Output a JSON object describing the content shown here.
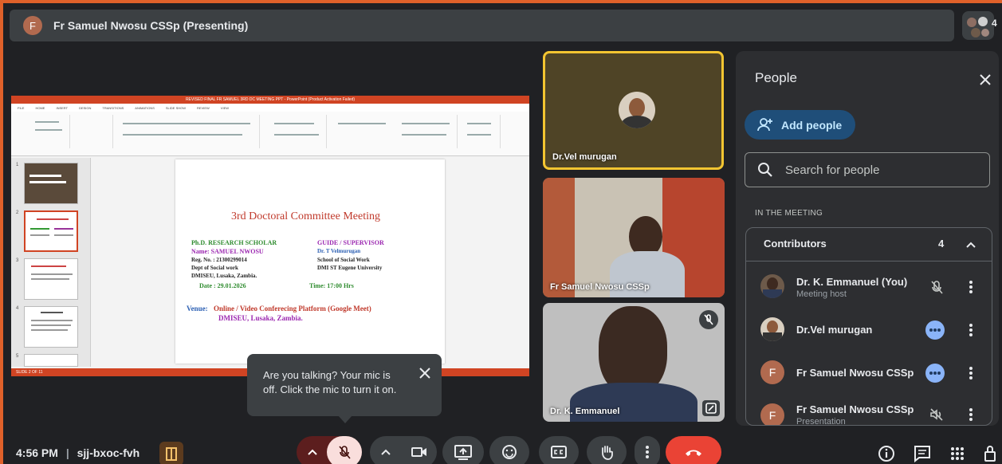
{
  "header": {
    "avatar_letter": "F",
    "title": "Fr Samuel Nwosu CSSp (Presenting)",
    "participant_count": "4"
  },
  "presentation": {
    "window_title": "REVISED FINAL FR SAMUEL 3RD DC MEETING PPT - PowerPoint (Product Activation Failed)",
    "tabs": [
      "FILE",
      "HOME",
      "INSERT",
      "DESIGN",
      "TRANSITIONS",
      "ANIMATIONS",
      "SLIDE SHOW",
      "REVIEW",
      "VIEW"
    ],
    "thumb_numbers": [
      "1",
      "2",
      "3",
      "4",
      "5"
    ],
    "slide": {
      "title": "3rd   Doctoral Committee Meeting",
      "scholar_heading": "Ph.D. RESEARCH SCHOLAR",
      "scholar_name": "Name: SAMUEL NWOSU",
      "reg_no": "Reg. No. : 21300299014",
      "dept": "Dept of Social work",
      "institution": "DMISEU, Lusaka, Zambia.",
      "date": "Date : 29.01.2026",
      "guide_heading": "GUIDE / SUPERVISOR",
      "guide_name": "Dr. T Velmurugan",
      "guide_school": "School of Social Work",
      "guide_univ": "DMI ST Eugene University",
      "time": "Time: 17:00 Hrs",
      "venue_label": "Venue:",
      "venue_value": "Online / Video Conferecing Platform (Google Meet)",
      "venue_place": "DMISEU, Lusaka, Zambia."
    },
    "statusbar_text": "SLIDE 2 OF 11"
  },
  "tiles": [
    {
      "name": "Dr.Vel murugan"
    },
    {
      "name": "Fr Samuel Nwosu CSSp"
    },
    {
      "name": "Dr. K. Emmanuel"
    }
  ],
  "people_panel": {
    "title": "People",
    "add_people": "Add people",
    "search_placeholder": "Search for people",
    "section": "IN THE MEETING",
    "group_label": "Contributors",
    "group_count": "4",
    "people": [
      {
        "name": "Dr. K. Emmanuel (You)",
        "sub": "Meeting host"
      },
      {
        "name": "Dr.Vel murugan",
        "sub": ""
      },
      {
        "name": "Fr Samuel Nwosu CSSp",
        "sub": "",
        "letter": "F"
      },
      {
        "name": "Fr Samuel Nwosu CSSp",
        "sub": "Presentation",
        "letter": "F"
      }
    ]
  },
  "tooltip": {
    "text": "Are you talking? Your mic is off. Click the mic to turn it on."
  },
  "bottom": {
    "time": "4:56 PM",
    "separator": "|",
    "meeting_code": "sjj-bxoc-fvh"
  },
  "colors": {
    "accent_blue": "#8ab4f8",
    "end_call": "#ea4335",
    "mic_off": "#f9dedc",
    "frame": "#e0612a"
  }
}
